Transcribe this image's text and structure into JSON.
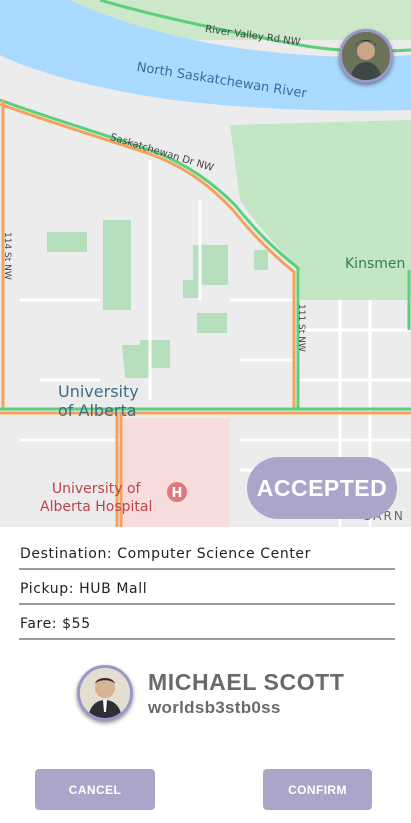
{
  "map": {
    "labels": {
      "river_valley_rd": "River Valley Rd NW",
      "river": "North Saskatchewan River",
      "sask_dr": "Saskatchewan Dr NW",
      "kinsmen": "Kinsmen",
      "st_114": "114 St NW",
      "st_111": "111 St NW",
      "university": "University\nof Alberta",
      "hospital": "University of\nAlberta Hospital",
      "garn": "GARN"
    }
  },
  "status": {
    "label": "ACCEPTED"
  },
  "trip": {
    "destination": "Destination: Computer Science Center",
    "pickup": "Pickup: HUB Mall",
    "fare": "Fare: $55"
  },
  "driver": {
    "name": "MICHAEL SCOTT",
    "username": "worldsb3stb0ss"
  },
  "actions": {
    "cancel_label": "CANCEL",
    "confirm_label": "CONFIRM"
  },
  "colors": {
    "accent": "#a9a6c9",
    "water": "#aadaff",
    "park": "#a8dcaf",
    "road_green": "#5bd07a",
    "road_orange": "#f4a25b",
    "hospital_area": "#f7dcdc"
  }
}
